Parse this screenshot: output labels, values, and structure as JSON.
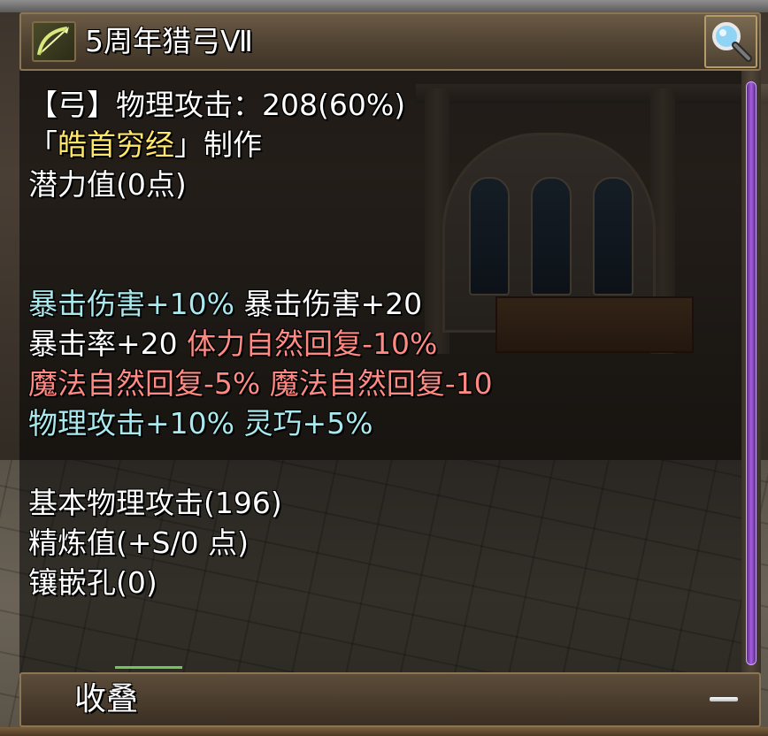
{
  "item": {
    "title": "5周年猎弓Ⅶ",
    "icon": "bow-icon"
  },
  "search_button": {
    "icon": "magnifier-icon"
  },
  "stats": {
    "attack_prefix": "【弓】物理攻击：208(60%)",
    "maker_open": "「",
    "maker_name": "皓首穷经",
    "maker_close": "」制作",
    "potential": "潜力值(0点)"
  },
  "bonuses": {
    "line1": [
      {
        "text": "暴击伤害+10%",
        "color": "#a9e8ec"
      },
      {
        "text": "暴击伤害+20",
        "color": "#ffffff"
      }
    ],
    "line2": [
      {
        "text": "暴击率+20",
        "color": "#ffffff"
      },
      {
        "text": "体力自然回复-10%",
        "color": "#ff8a84"
      }
    ],
    "line3": [
      {
        "text": "魔法自然回复-5%",
        "color": "#ff8a84"
      },
      {
        "text": "魔法自然回复-10",
        "color": "#ff8a84"
      }
    ],
    "line4": [
      {
        "text": "物理攻击+10%",
        "color": "#a9e8ec"
      },
      {
        "text": "灵巧+5%",
        "color": "#a9e8ec"
      }
    ]
  },
  "base": {
    "base_attack": "基本物理攻击(196)",
    "refine": "精炼值(+S/0 点)",
    "sockets": "镶嵌孔(0)"
  },
  "footer": {
    "collapse_label": "收叠",
    "minus_icon": "minus-icon"
  },
  "colors": {
    "cyan": "#a9e8ec",
    "red": "#ff8a84",
    "gold": "#ffe66b",
    "scrollbar": "#a65de3"
  }
}
